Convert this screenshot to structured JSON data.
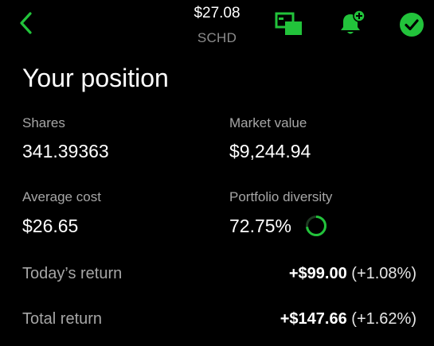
{
  "header": {
    "price": "$27.08",
    "ticker": "SCHD",
    "accent_color": "#22c33b",
    "icons": [
      "back-chevron-icon",
      "picture-in-picture-icon",
      "add-alert-bell-icon",
      "checkmark-circle-icon"
    ]
  },
  "position": {
    "title": "Your position",
    "shares": {
      "label": "Shares",
      "value": "341.39363"
    },
    "market_value": {
      "label": "Market value",
      "value": "$9,244.94"
    },
    "average_cost": {
      "label": "Average cost",
      "value": "$26.65"
    },
    "portfolio_diversity": {
      "label": "Portfolio diversity",
      "value": "72.75%",
      "fraction": 0.7275
    },
    "todays_return": {
      "label": "Today’s return",
      "amount": "+$99.00",
      "percent": "(+1.08%)"
    },
    "total_return": {
      "label": "Total return",
      "amount": "+$147.66",
      "percent": "(+1.62%)"
    }
  }
}
